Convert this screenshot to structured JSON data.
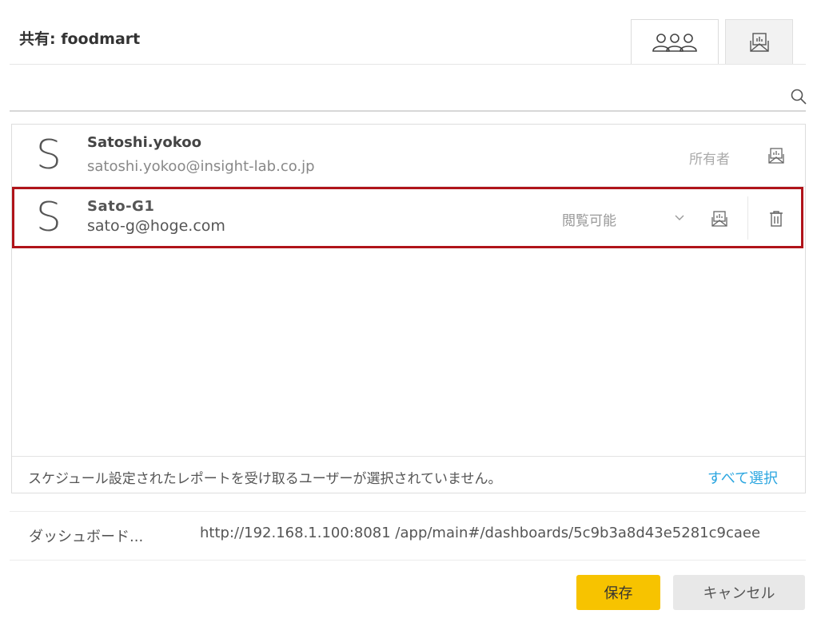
{
  "dialog": {
    "title": "共有: foodmart"
  },
  "tabs": [
    {
      "name": "users-tab",
      "icon": "users-icon",
      "active": true
    },
    {
      "name": "reports-tab",
      "icon": "report-envelope-icon",
      "active": false
    }
  ],
  "search": {
    "placeholder": "",
    "value": "",
    "icon": "search-icon"
  },
  "users": [
    {
      "avatar": "S",
      "name": "Satoshi.yokoo",
      "email": "satoshi.yokoo@insight-lab.co.jp",
      "role": "所有者",
      "report_icon": "report-envelope-icon"
    },
    {
      "avatar": "S",
      "name": "Sato-G1",
      "email": "sato-g@hoge.com",
      "role": "閲覧可能",
      "report_icon": "report-envelope-icon",
      "delete_icon": "trash-icon",
      "highlighted": true
    }
  ],
  "list_footer": {
    "message": "スケジュール設定されたレポートを受け取るユーザーが選択されていません。",
    "select_all": "すべて選択"
  },
  "dashboard_url": {
    "label": "ダッシュボード...",
    "value": "http://192.168.1.100:8081 /app/main#/dashboards/5c9b3a8d43e5281c9caee"
  },
  "buttons": {
    "save": "保存",
    "cancel": "キャンセル"
  },
  "colors": {
    "accent": "#f7c300",
    "link": "#2ba6e0",
    "highlight": "#b0141a"
  }
}
